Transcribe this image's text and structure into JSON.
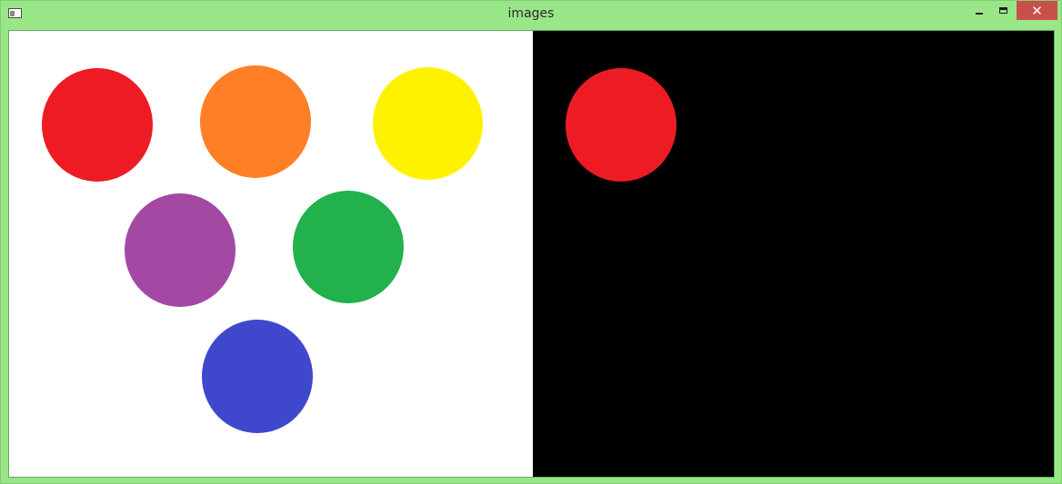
{
  "window": {
    "title": "images"
  },
  "titlebar_controls": {
    "minimize_icon": "minimize-icon",
    "maximize_icon": "maximize-icon",
    "close_icon": "close-icon",
    "close_glyph": "✕"
  },
  "colors": {
    "frame": "#99e688",
    "close_button": "#c9504a",
    "left_background": "#ffffff",
    "right_background": "#000000"
  },
  "left_image": {
    "circles": [
      {
        "name": "red",
        "color": "#ed1c24"
      },
      {
        "name": "orange",
        "color": "#ff7f27"
      },
      {
        "name": "yellow",
        "color": "#fff200"
      },
      {
        "name": "purple",
        "color": "#a349a4"
      },
      {
        "name": "green",
        "color": "#22b14c"
      },
      {
        "name": "blue",
        "color": "#3f48cc"
      }
    ]
  },
  "right_image": {
    "circles": [
      {
        "name": "red",
        "color": "#ed1c24"
      }
    ]
  }
}
